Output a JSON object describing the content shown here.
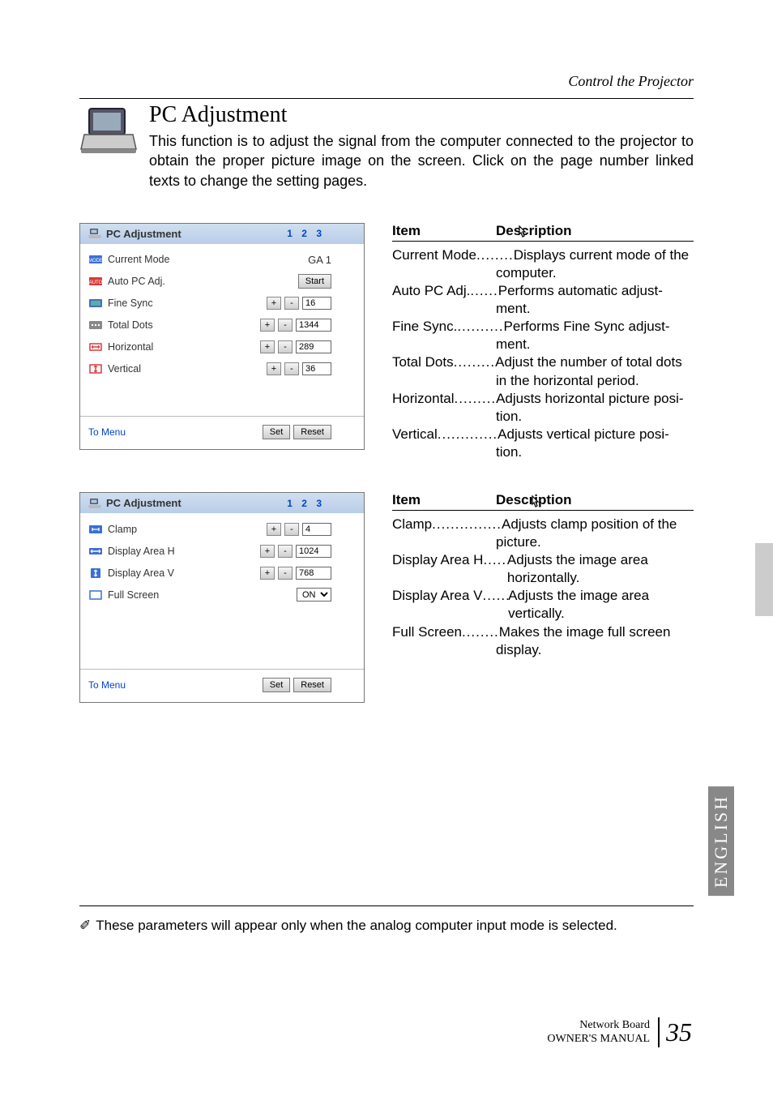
{
  "chapter": "Control the Projector",
  "heading": "PC Adjustment",
  "intro": "This function is to adjust the signal from the computer connected to the projector to obtain the proper picture image on the screen. Click on the page number linked texts to change the setting pages.",
  "panel1": {
    "title": "PC Adjustment",
    "pager": "1 2 3",
    "rows": {
      "current_mode": {
        "label": "Current Mode",
        "value": "GA 1"
      },
      "auto_pc": {
        "label": "Auto PC Adj.",
        "button": "Start"
      },
      "fine_sync": {
        "label": "Fine Sync",
        "value": "16"
      },
      "total_dots": {
        "label": "Total Dots",
        "value": "1344"
      },
      "horizontal": {
        "label": "Horizontal",
        "value": "289"
      },
      "vertical": {
        "label": "Vertical",
        "value": "36"
      }
    },
    "to_menu": "To Menu",
    "set": "Set",
    "reset": "Reset"
  },
  "panel2": {
    "title": "PC Adjustment",
    "pager": "1 2 3",
    "rows": {
      "clamp": {
        "label": "Clamp",
        "value": "4"
      },
      "darea_h": {
        "label": "Display Area H",
        "value": "1024"
      },
      "darea_v": {
        "label": "Display Area V",
        "value": "768"
      },
      "full_screen": {
        "label": "Full Screen",
        "value": "ON"
      }
    },
    "to_menu": "To Menu",
    "set": "Set",
    "reset": "Reset"
  },
  "desc_heads": {
    "item": "Item",
    "description": "Description"
  },
  "desc1": [
    {
      "term": "Current Mode",
      "dots": "........",
      "def": "Displays current mode of the",
      "cont": "computer."
    },
    {
      "term": "Auto PC Adj.",
      "dots": "......",
      "def": "Performs automatic adjust-",
      "cont": "ment."
    },
    {
      "term": "Fine Sync.",
      "dots": "..........",
      "def": "Performs Fine Sync adjust-",
      "cont": "ment."
    },
    {
      "term": "Total Dots",
      "dots": ".........",
      "def": "Adjust the number of total dots",
      "cont": "in the horizontal period."
    },
    {
      "term": "Horizontal",
      "dots": ".........",
      "def": "Adjusts horizontal picture posi-",
      "cont": "tion."
    },
    {
      "term": "Vertical",
      "dots": ".............",
      "def": "Adjusts vertical picture posi-",
      "cont": "tion."
    }
  ],
  "desc2": [
    {
      "term": "Clamp",
      "dots": "...............",
      "def": "Adjusts clamp position of the",
      "cont": "picture."
    },
    {
      "term": "Display Area H",
      "dots": "......",
      "def": "Adjusts the image area horizontally.",
      "cont": ""
    },
    {
      "term": "Display Area V",
      "dots": "......",
      "def": "Adjusts the image area vertically.",
      "cont": ""
    },
    {
      "term": "Full Screen",
      "dots": "........",
      "def": "Makes the image full screen",
      "cont": "display."
    }
  ],
  "english_tab": "ENGLISH",
  "footnote": "These parameters will appear only when the analog computer input mode is selected.",
  "footer": {
    "line1": "Network Board",
    "line2": "OWNER'S MANUAL",
    "page": "35"
  }
}
